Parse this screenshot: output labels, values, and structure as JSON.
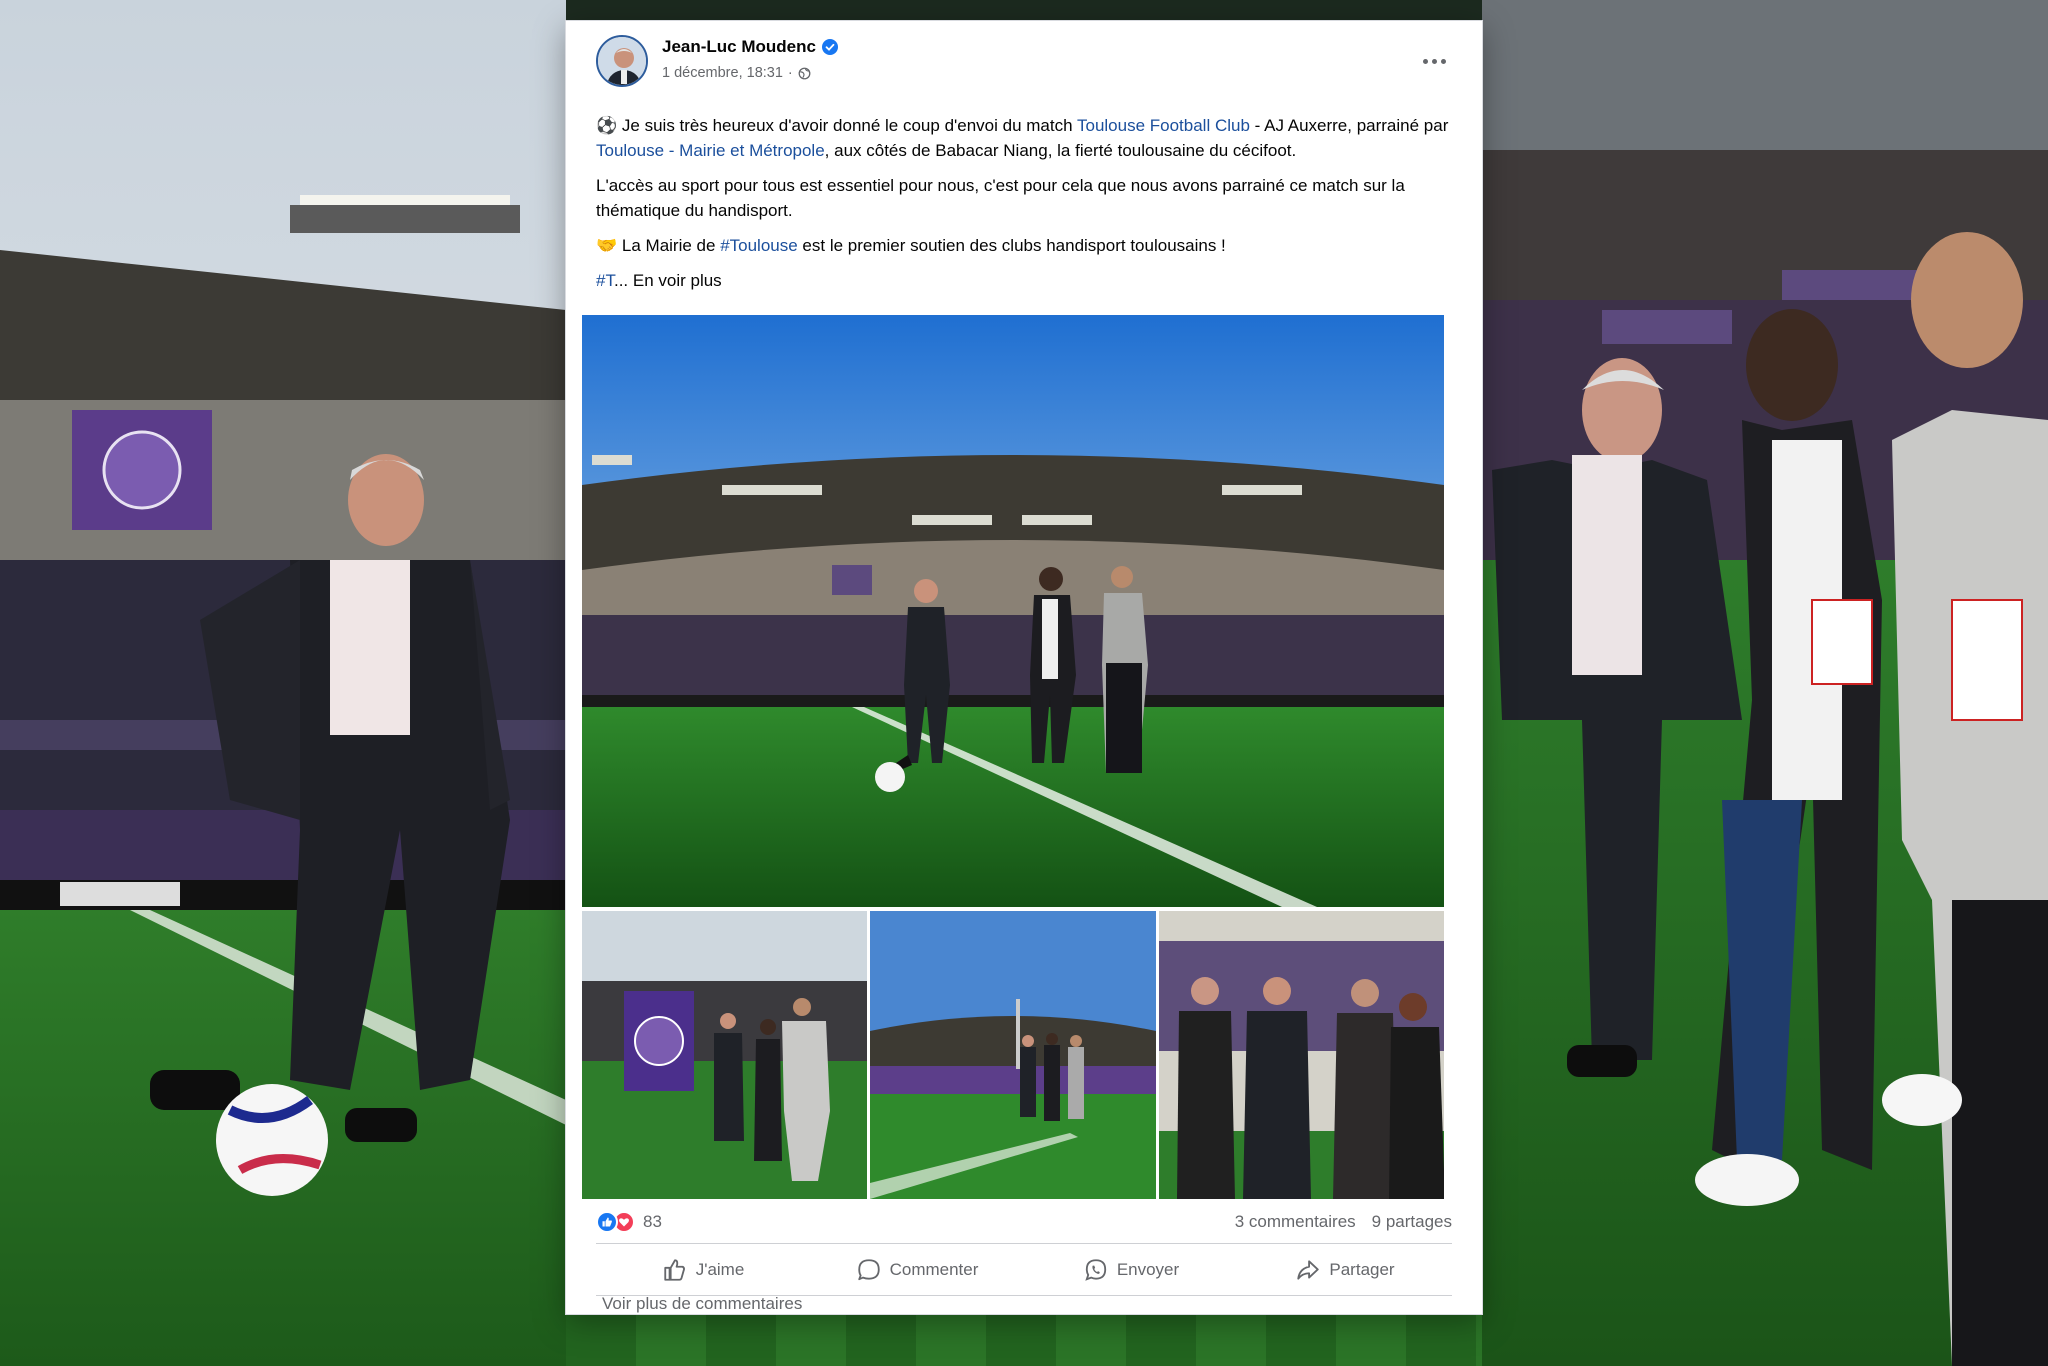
{
  "post": {
    "author": "Jean-Luc Moudenc",
    "timestamp": "1 décembre, 18:31",
    "privacy_icon": "globe-icon",
    "paragraph1": {
      "a": "Je suis très heureux d'avoir donné le coup d'envoi du match ",
      "link1": "Toulouse Football Club",
      "b": " - AJ Auxerre, parrainé par ",
      "link2": "Toulouse - Mairie et Métropole",
      "c": ", aux côtés de Babacar Niang, la fierté toulousaine du cécifoot."
    },
    "paragraph2": "L'accès au sport pour tous est essentiel pour nous, c'est pour cela que nous avons parrainé ce match sur la thématique du handisport.",
    "paragraph3": {
      "a": "La Mairie de ",
      "hashtag": "#Toulouse",
      "b": " est le premier soutien des clubs handisport toulousains !"
    },
    "paragraph4": {
      "hashtag": "#T",
      "ellipsis": "...",
      "see_more": " En voir plus"
    },
    "reactions_count": "83",
    "comments": "3 commentaires",
    "shares": "9 partages",
    "actions": {
      "like": "J'aime",
      "comment": "Commenter",
      "send": "Envoyer",
      "share": "Partager"
    },
    "more_comments": "Voir plus de commentaires"
  },
  "colors": {
    "link": "#1b4f9c",
    "secondary_text": "#65676b",
    "like_blue": "#1877f2",
    "love_red": "#f33e58"
  }
}
